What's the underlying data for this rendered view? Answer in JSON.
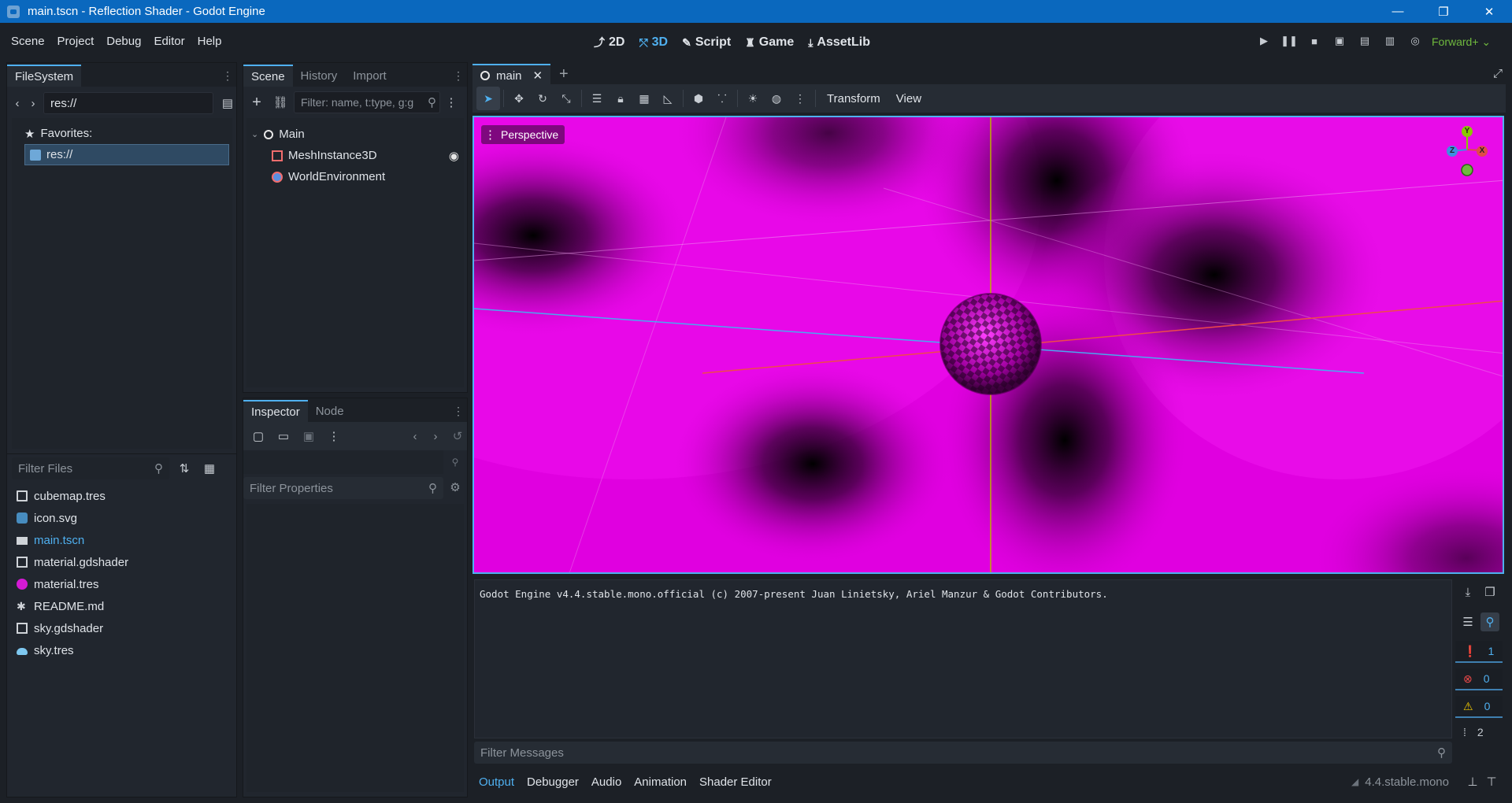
{
  "window": {
    "title": "main.tscn - Reflection Shader - Godot Engine",
    "minimize": "—",
    "maximize": "❐",
    "close": "✕"
  },
  "menu": [
    "Scene",
    "Project",
    "Debug",
    "Editor",
    "Help"
  ],
  "workspaces": [
    {
      "label": "2D",
      "icon": "2d-icon"
    },
    {
      "label": "3D",
      "icon": "3d-icon",
      "active": true
    },
    {
      "label": "Script",
      "icon": "script-icon"
    },
    {
      "label": "Game",
      "icon": "game-icon"
    },
    {
      "label": "AssetLib",
      "icon": "assetlib-icon"
    }
  ],
  "renderer": "Forward+",
  "filesystem": {
    "tab": "FileSystem",
    "path": "res://",
    "favorites_label": "Favorites:",
    "selected_dir": "res://",
    "filter_placeholder": "Filter Files",
    "files": [
      {
        "name": "cubemap.tres",
        "icon": "resource-icon"
      },
      {
        "name": "icon.svg",
        "icon": "image-icon"
      },
      {
        "name": "main.tscn",
        "icon": "scene-icon",
        "current": true
      },
      {
        "name": "material.gdshader",
        "icon": "shader-icon"
      },
      {
        "name": "material.tres",
        "icon": "material-icon"
      },
      {
        "name": "README.md",
        "icon": "text-icon"
      },
      {
        "name": "sky.gdshader",
        "icon": "shader-icon"
      },
      {
        "name": "sky.tres",
        "icon": "sky-icon"
      }
    ]
  },
  "scene": {
    "tabs": [
      "Scene",
      "History",
      "Import"
    ],
    "filter_placeholder": "Filter: name, t:type, g:g",
    "nodes": [
      {
        "name": "Main",
        "icon": "node3d-icon"
      },
      {
        "name": "MeshInstance3D",
        "icon": "mesh-icon"
      },
      {
        "name": "WorldEnvironment",
        "icon": "world-environment-icon"
      }
    ]
  },
  "inspector": {
    "tabs": [
      "Inspector",
      "Node"
    ],
    "filter_placeholder": "Filter Properties"
  },
  "editor_tab": "main",
  "viewport": {
    "toolbar_labels": [
      "Transform",
      "View"
    ],
    "perspective_label": "Perspective",
    "gizmo": {
      "y": "Y",
      "z": "Z",
      "x": "X"
    },
    "colors": {
      "background": "#e600e6",
      "axis_x": "#f04a4a",
      "axis_z": "#4aa8f0",
      "axis_y": "#b8b400"
    }
  },
  "output": {
    "log": "Godot Engine v4.4.stable.mono.official (c) 2007-present Juan Linietsky, Ariel Manzur & Godot Contributors.",
    "filter_placeholder": "Filter Messages",
    "counts": {
      "messages": "1",
      "errors": "0",
      "warnings": "0",
      "lines": "2"
    },
    "tabs": [
      "Output",
      "Debugger",
      "Audio",
      "Animation",
      "Shader Editor"
    ],
    "version": "4.4.stable.mono"
  }
}
